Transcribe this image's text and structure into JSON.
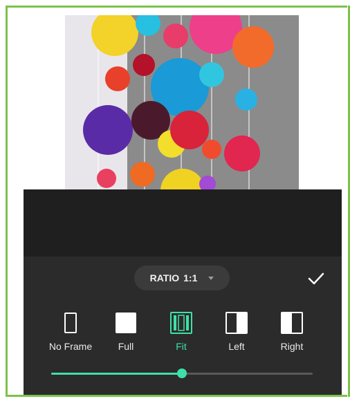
{
  "ratio": {
    "label": "RATIO",
    "value": "1:1"
  },
  "options": [
    {
      "label": "No Frame",
      "icon": "no-frame-icon",
      "active": false
    },
    {
      "label": "Full",
      "icon": "full-frame-icon",
      "active": false
    },
    {
      "label": "Fit",
      "icon": "fit-frame-icon",
      "active": true
    },
    {
      "label": "Left",
      "icon": "left-frame-icon",
      "active": false
    },
    {
      "label": "Right",
      "icon": "right-frame-icon",
      "active": false
    }
  ],
  "slider": {
    "value_fraction": 0.5
  },
  "colors": {
    "accent": "#3fe0a8",
    "panel": "#2b2b2b",
    "border": "#7cc24a"
  }
}
